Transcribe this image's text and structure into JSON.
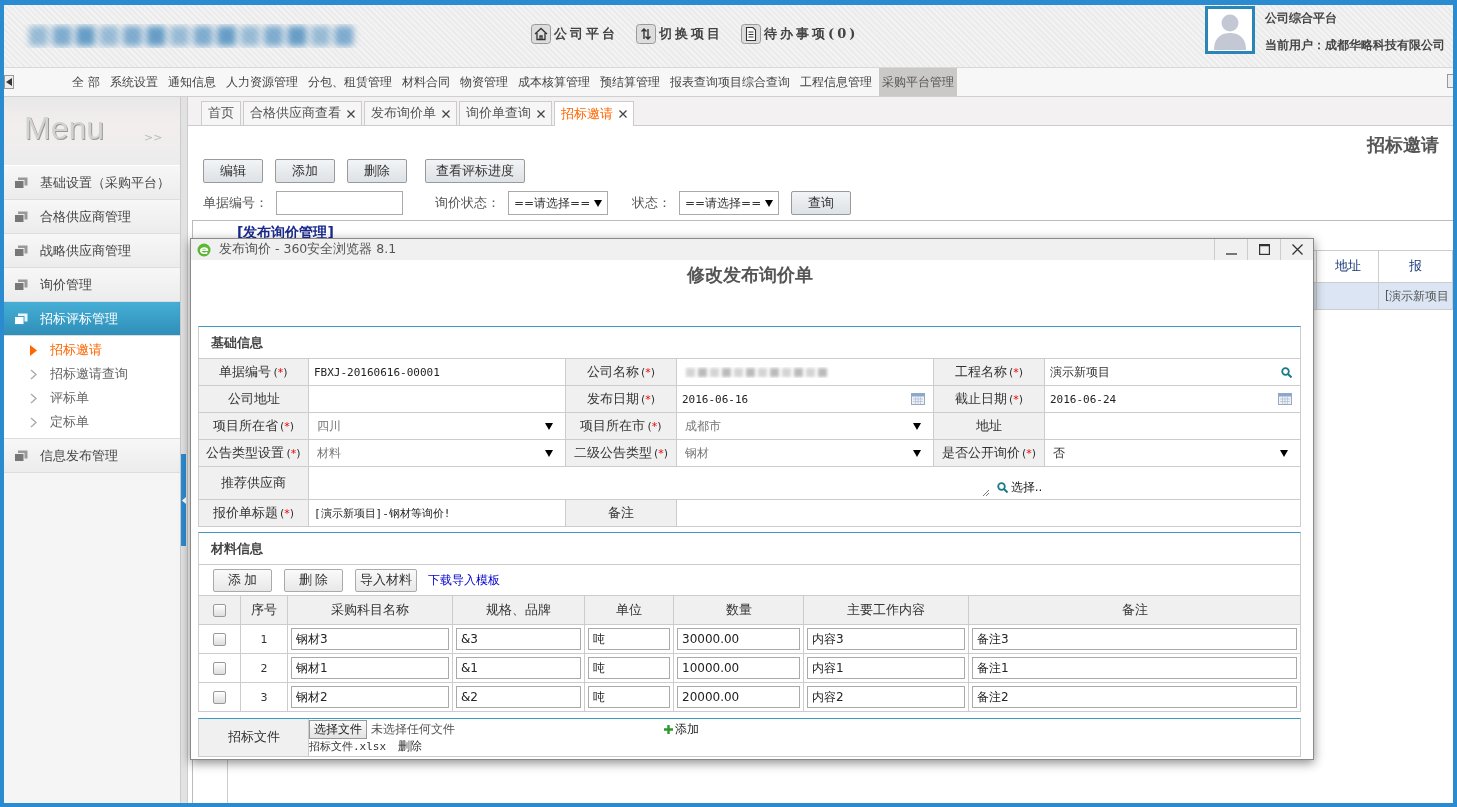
{
  "header": {
    "nav_links": [
      {
        "kind": "home",
        "label": "公司平台"
      },
      {
        "kind": "switch",
        "label": "切换项目"
      },
      {
        "kind": "document",
        "label": "待办事项(0)"
      }
    ],
    "platform_title": "公司综合平台",
    "current_user": "当前用户：成都华略科技有限公司"
  },
  "menu_bar": [
    {
      "label": "全 部",
      "selected": false
    },
    {
      "label": "系统设置",
      "selected": false
    },
    {
      "label": "通知信息",
      "selected": false
    },
    {
      "label": "人力资源管理",
      "selected": false
    },
    {
      "label": "分包、租赁管理",
      "selected": false
    },
    {
      "label": "材料合同",
      "selected": false
    },
    {
      "label": "物资管理",
      "selected": false
    },
    {
      "label": "成本核算管理",
      "selected": false
    },
    {
      "label": "预结算管理",
      "selected": false
    },
    {
      "label": "报表查询项目综合查询",
      "selected": false
    },
    {
      "label": "工程信息管理",
      "selected": false
    },
    {
      "label": "采购平台管理",
      "selected": true
    }
  ],
  "sidebar": {
    "title": "Menu",
    "toggle": ">>",
    "groups": [
      {
        "label": "基础设置（采购平台）",
        "selected": false
      },
      {
        "label": "合格供应商管理",
        "selected": false
      },
      {
        "label": "战略供应商管理",
        "selected": false
      },
      {
        "label": "询价管理",
        "selected": false
      },
      {
        "label": "招标评标管理",
        "selected": true,
        "children": [
          {
            "label": "招标邀请",
            "selected": true
          },
          {
            "label": "招标邀请查询",
            "selected": false
          },
          {
            "label": "评标单",
            "selected": false
          },
          {
            "label": "定标单",
            "selected": false
          }
        ]
      },
      {
        "label": "信息发布管理",
        "selected": false
      }
    ]
  },
  "tabs": [
    {
      "label": "首页",
      "selected": false,
      "closable": false
    },
    {
      "label": "合格供应商查看",
      "selected": false,
      "closable": true
    },
    {
      "label": "发布询价单",
      "selected": false,
      "closable": true
    },
    {
      "label": "询价单查询",
      "selected": false,
      "closable": true
    },
    {
      "label": "招标邀请",
      "selected": true,
      "closable": true
    }
  ],
  "page": {
    "title": "招标邀请",
    "buttons": [
      "编辑",
      "添加",
      "删除",
      "查看评标进度"
    ],
    "filters": [
      {
        "kind": "text",
        "label": "单据编号："
      },
      {
        "kind": "select",
        "label": "询价状态：",
        "value": "==请选择=="
      },
      {
        "kind": "select",
        "label": "状态：",
        "value": "==请选择=="
      }
    ],
    "search_button": "查询",
    "grid": {
      "caption": "[发布询价管理]",
      "columns": [
        "地址",
        "报"
      ],
      "rows": [
        {
          "selected": true,
          "cells": [
            null,
            "[演示新项目"
          ]
        }
      ]
    }
  },
  "dialog": {
    "title": "发布询价 - 360安全浏览器 8.1",
    "heading": "修改发布询价单",
    "basic_info": {
      "title": "基础信息",
      "rows": [
        [
          {
            "label": "单据编号",
            "mark": "(*)",
            "kind": "text",
            "value": "FBXJ-20160616-00001"
          },
          {
            "label": "公司名称",
            "mark": "(*)",
            "kind": "blurred"
          },
          {
            "label": "工程名称",
            "mark": "(*)",
            "kind": "lookup",
            "value": "演示新项目"
          }
        ],
        [
          {
            "label": "公司地址",
            "kind": "text"
          },
          {
            "label": "发布日期",
            "mark": "(*)",
            "kind": "date",
            "value": "2016-06-16"
          },
          {
            "label": "截止日期",
            "mark": "(*)",
            "kind": "date",
            "value": "2016-06-24"
          }
        ],
        [
          {
            "label": "项目所在省",
            "mark": "(*)",
            "kind": "select",
            "value": "四川",
            "disabled": true
          },
          {
            "label": "项目所在市",
            "mark": "(*)",
            "kind": "select",
            "value": "成都市",
            "disabled": true
          },
          {
            "label": "地址",
            "kind": "text"
          }
        ],
        [
          {
            "label": "公告类型设置",
            "mark": "(*)",
            "kind": "select",
            "value": "材料",
            "disabled": true
          },
          {
            "label": "二级公告类型",
            "mark": "(*)",
            "kind": "select",
            "value": "钢材",
            "disabled": true
          },
          {
            "label": "是否公开询价",
            "mark": "(*)",
            "kind": "select",
            "value": "否",
            "disabled": false
          }
        ],
        [
          {
            "label": "推荐供应商",
            "kind": "picker",
            "action": "选择.."
          }
        ],
        [
          {
            "label": "报价单标题",
            "mark": "(*)",
            "kind": "text",
            "value": "[演示新项目]-钢材等询价!"
          },
          {
            "label": "备注",
            "kind": "text"
          }
        ]
      ]
    },
    "materials": {
      "title": "材料信息",
      "buttons": [
        "添 加",
        "删 除",
        "导入材料"
      ],
      "template_link": "下载导入模板",
      "all_checked": false,
      "columns": [
        "序号",
        "采购科目名称",
        "规格、品牌",
        "单位",
        "数量",
        "主要工作内容",
        "备注"
      ],
      "rows": [
        {
          "checked": false,
          "index": "1",
          "cells": [
            "钢材3",
            "&3",
            "吨",
            "30000.00",
            "内容3",
            "备注3"
          ]
        },
        {
          "checked": false,
          "index": "2",
          "cells": [
            "钢材1",
            "&1",
            "吨",
            "10000.00",
            "内容1",
            "备注1"
          ]
        },
        {
          "checked": false,
          "index": "3",
          "cells": [
            "钢材2",
            "&2",
            "吨",
            "20000.00",
            "内容2",
            "备注2"
          ]
        }
      ]
    },
    "attachments": {
      "label": "招标文件",
      "choose_button": "选择文件",
      "no_file": "未选择任何文件",
      "add_link": "添加",
      "files": [
        {
          "name": "招标文件.xlsx",
          "delete": "删除"
        }
      ]
    }
  }
}
